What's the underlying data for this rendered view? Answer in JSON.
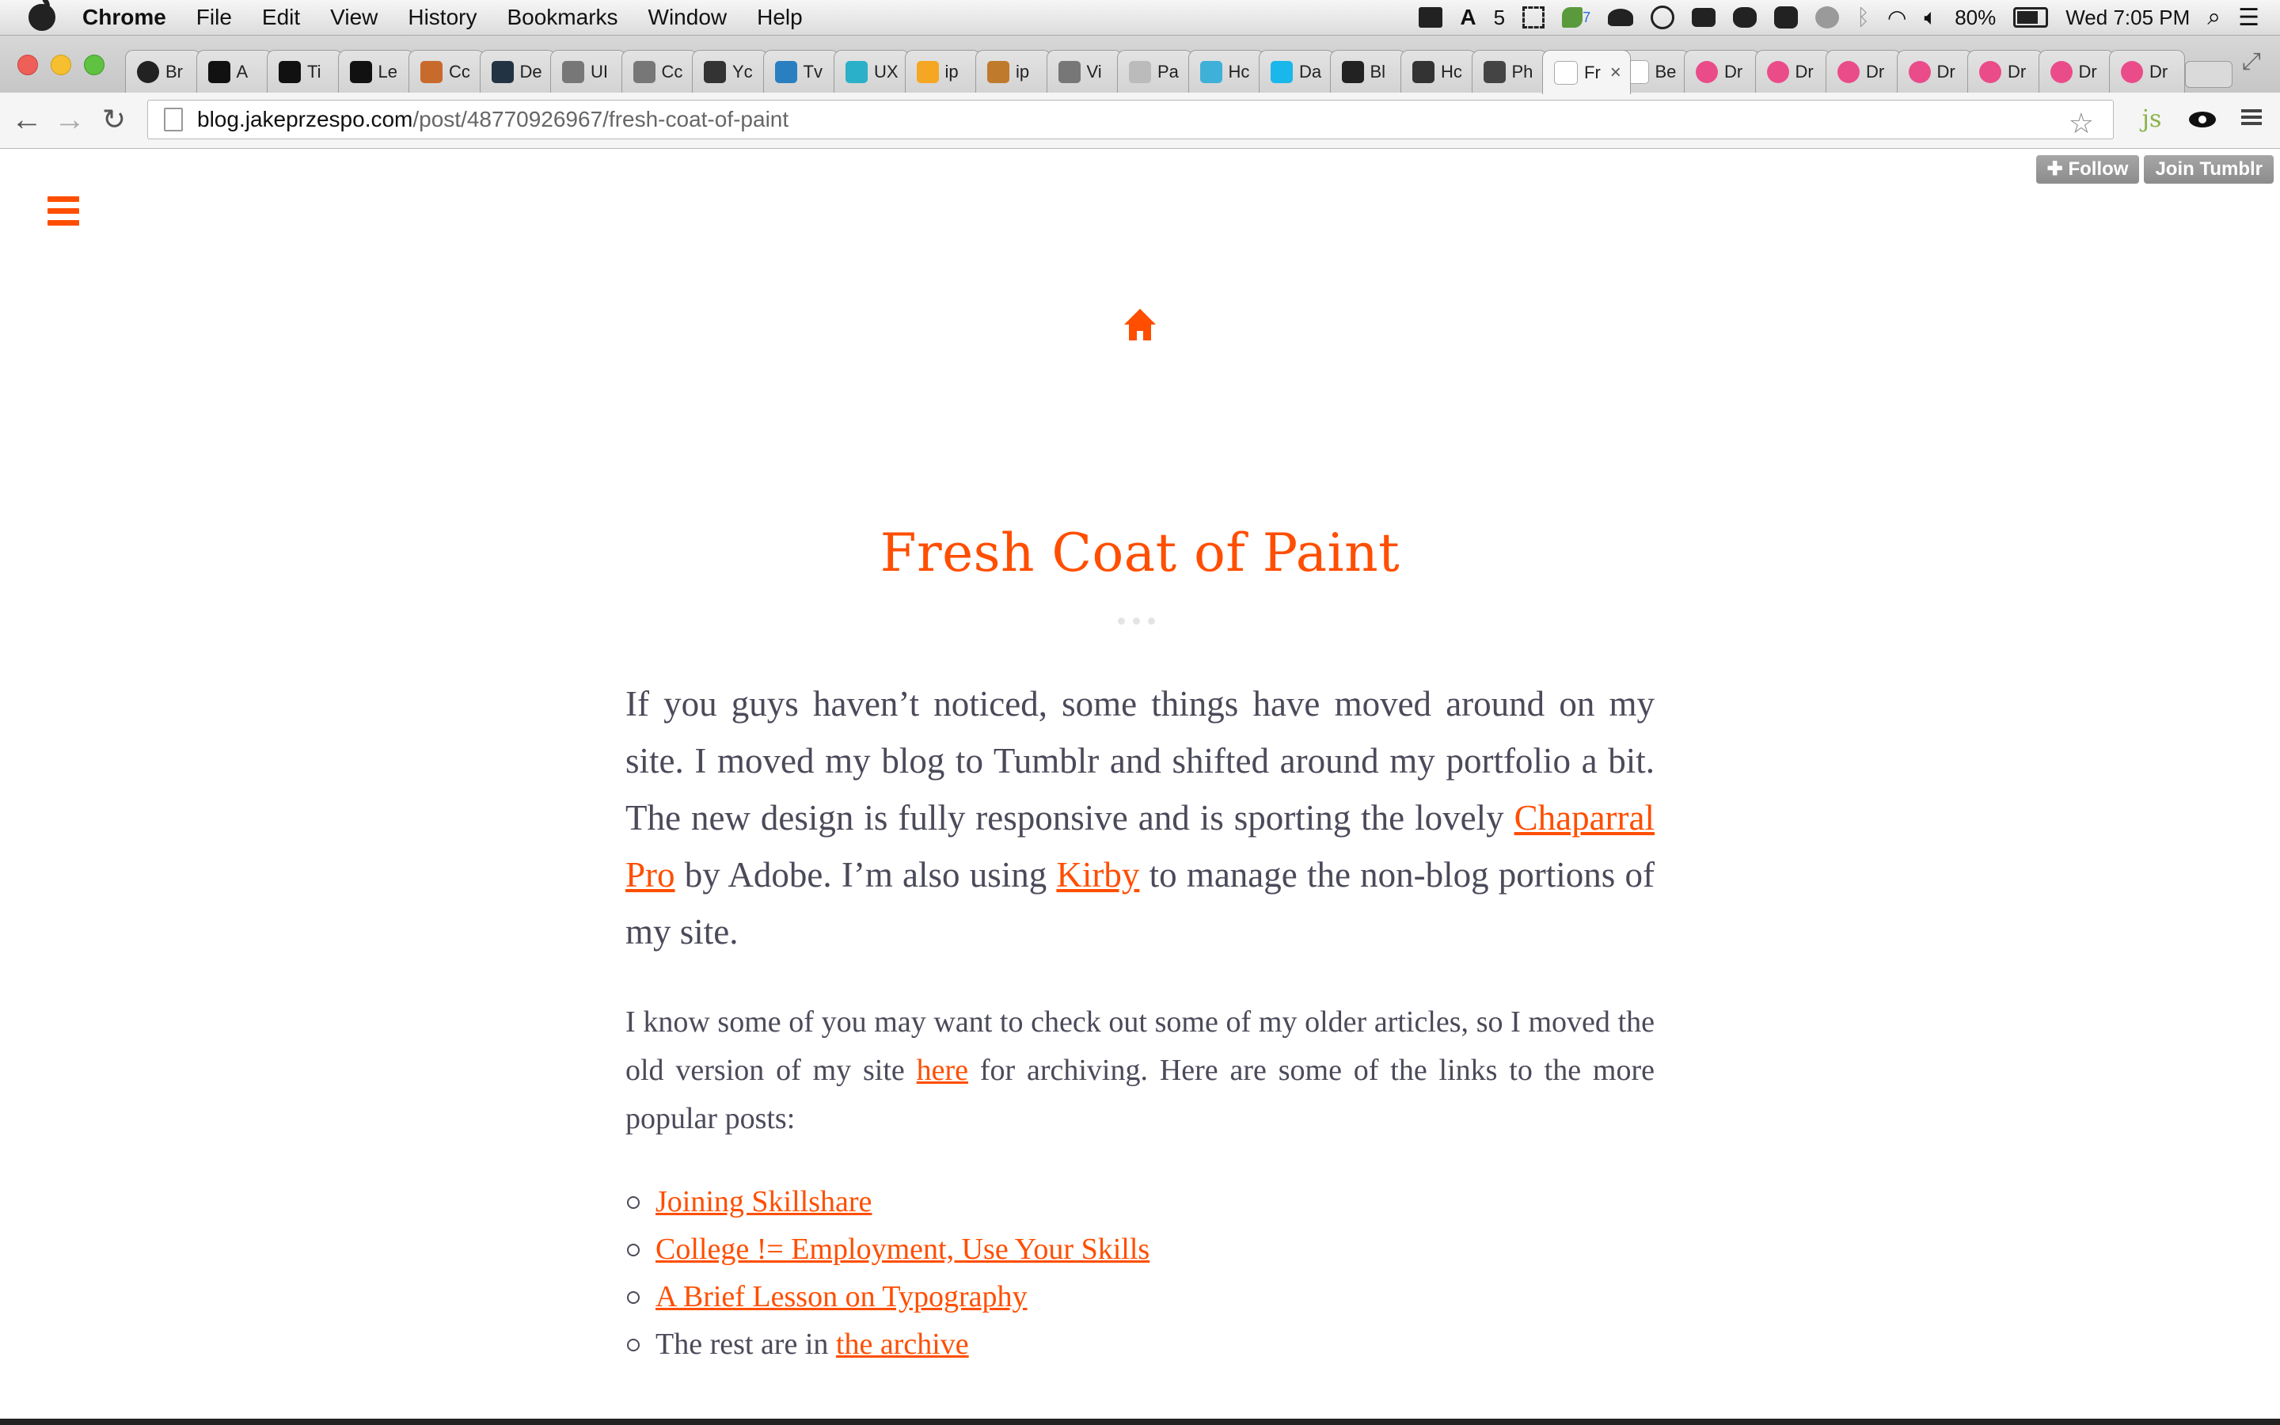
{
  "menubar": {
    "app": "Chrome",
    "items": [
      "File",
      "Edit",
      "View",
      "History",
      "Bookmarks",
      "Window",
      "Help"
    ],
    "status": {
      "adobe_count": "5",
      "evernote_badge": "7",
      "battery": "80%",
      "clock": "Wed 7:05 PM"
    }
  },
  "tabs": [
    {
      "label": "Br",
      "icon": "github-icon",
      "color": "#222222"
    },
    {
      "label": "A",
      "icon": "medium-icon",
      "color": "#111111"
    },
    {
      "label": "Ti",
      "icon": "page-icon",
      "color": "#111111"
    },
    {
      "label": "Le",
      "icon": "page-icon",
      "color": "#111111"
    },
    {
      "label": "Cc",
      "icon": "coffee-icon",
      "color": "#c86a2c"
    },
    {
      "label": "De",
      "icon": "page-icon",
      "color": "#223344"
    },
    {
      "label": "UI",
      "icon": "apple-icon",
      "color": "#777777"
    },
    {
      "label": "Cc",
      "icon": "apple-icon",
      "color": "#777777"
    },
    {
      "label": "Yc",
      "icon": "page-icon",
      "color": "#333333"
    },
    {
      "label": "Tv",
      "icon": "page-icon",
      "color": "#2a7fc0"
    },
    {
      "label": "UX",
      "icon": "page-icon",
      "color": "#2ab0c8"
    },
    {
      "label": "ip",
      "icon": "page-icon",
      "color": "#f5a623"
    },
    {
      "label": "ip",
      "icon": "stack-icon",
      "color": "#c07a2c"
    },
    {
      "label": "Vi",
      "icon": "apple-icon",
      "color": "#777777"
    },
    {
      "label": "Pa",
      "icon": "page-icon",
      "color": "#bbbbbb"
    },
    {
      "label": "Hc",
      "icon": "quote-icon",
      "color": "#3fb0d8"
    },
    {
      "label": "Da",
      "icon": "vimeo-icon",
      "color": "#1ab7ea"
    },
    {
      "label": "Bl",
      "icon": "tools-icon",
      "color": "#222222"
    },
    {
      "label": "Hc",
      "icon": "page-icon",
      "color": "#333333"
    },
    {
      "label": "Ph",
      "icon": "page-icon",
      "color": "#444444"
    },
    {
      "label": "Fr",
      "icon": "page-icon",
      "color": "#ffffff",
      "active": true
    },
    {
      "label": "Be",
      "icon": "page-icon",
      "color": "#ffffff"
    },
    {
      "label": "Dr",
      "icon": "dribbble-icon",
      "color": "#ea4c89"
    },
    {
      "label": "Dr",
      "icon": "dribbble-icon",
      "color": "#ea4c89"
    },
    {
      "label": "Dr",
      "icon": "dribbble-icon",
      "color": "#ea4c89"
    },
    {
      "label": "Dr",
      "icon": "dribbble-icon",
      "color": "#ea4c89"
    },
    {
      "label": "Dr",
      "icon": "dribbble-icon",
      "color": "#ea4c89"
    },
    {
      "label": "Dr",
      "icon": "dribbble-icon",
      "color": "#ea4c89"
    },
    {
      "label": "Dr",
      "icon": "dribbble-icon",
      "color": "#ea4c89"
    }
  ],
  "toolbar": {
    "url_host": "blog.jakeprzespo.com",
    "url_path": "/post/48770926967/fresh-coat-of-paint",
    "extension_js": "js"
  },
  "tumblr": {
    "follow": "Follow",
    "join": "Join Tumblr"
  },
  "post": {
    "title": "Fresh Coat of Paint",
    "lead_1": "If you guys haven’t noticed, some things have moved around on my site. I moved my blog to Tumblr and shifted around my portfolio a bit. The new design is fully responsive and is sporting the lovely ",
    "lead_link_1": "Chaparral Pro",
    "lead_2": " by Adobe. I’m also using ",
    "lead_link_2": "Kirby",
    "lead_3": " to manage the non-blog portions of my site.",
    "para_1": "I know some of you may want to check out some of my older articles, so I moved the old version of my site ",
    "para_link": "here",
    "para_2": " for archiving. Here are some of the links to the more popular posts:",
    "links": [
      "Joining Skillshare",
      "College != Employment, Use Your Skills",
      "A Brief Lesson on Typography"
    ],
    "last_item_text": "The rest are in ",
    "last_item_link": "the archive"
  },
  "colors": {
    "accent": "#ff4e00",
    "body_text": "#4a4a5a"
  }
}
